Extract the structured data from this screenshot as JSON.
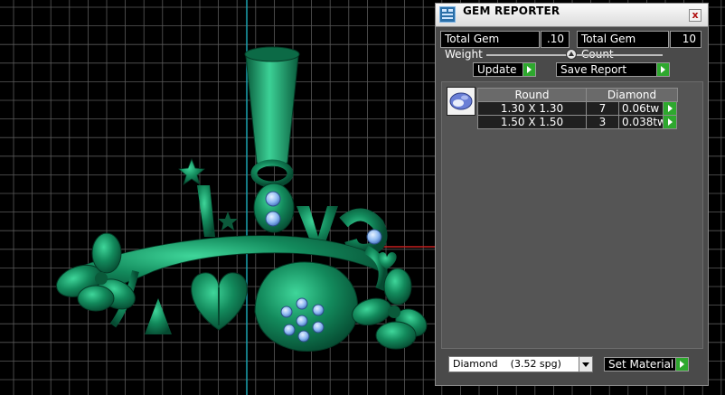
{
  "window": {
    "title": "GEM REPORTER",
    "close_glyph": "x"
  },
  "totals": {
    "weight_label": "Total Gem Weight",
    "weight_value": ".10",
    "count_label": "Total Gem Count",
    "count_value": "10"
  },
  "buttons": {
    "update": "Update",
    "save_report": "Save Report",
    "set_material": "Set Material"
  },
  "table": {
    "headers": [
      "Round",
      "Diamond"
    ],
    "rows": [
      {
        "size": "1.30 X 1.30",
        "count": "7",
        "weight": "0.06tw"
      },
      {
        "size": "1.50 X 1.50",
        "count": "3",
        "weight": "0.038tw"
      }
    ]
  },
  "material": {
    "selected": "Diamond    (3.52 spg)"
  },
  "colors": {
    "metal": "#0f6e4a",
    "metal_highlight": "#37c48b",
    "gem": "#8fbaf2",
    "grid": "#5a5a5a",
    "axis_y": "#1aa3b0",
    "axis_x": "#c42020",
    "go_arrow": "#2ea82e"
  },
  "icons": {
    "app": "gem-reporter-app-icon",
    "gem": "round-gem-icon",
    "close": "close-icon"
  }
}
